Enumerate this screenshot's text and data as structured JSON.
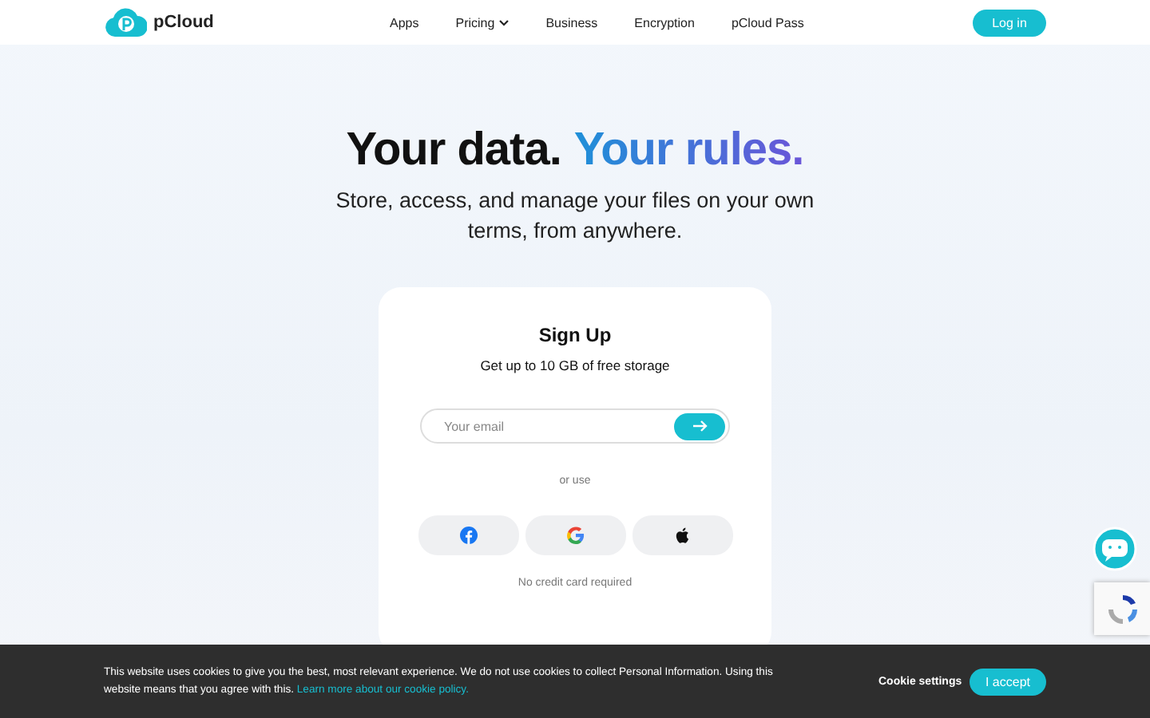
{
  "header": {
    "logo": "pCloud",
    "nav": [
      {
        "label": "Apps",
        "dropdown": false
      },
      {
        "label": "Pricing",
        "dropdown": true
      },
      {
        "label": "Business",
        "dropdown": false
      },
      {
        "label": "Encryption",
        "dropdown": false
      },
      {
        "label": "pCloud Pass",
        "dropdown": false
      }
    ],
    "login": "Log in"
  },
  "hero": {
    "headline": [
      {
        "text": "Your data.",
        "kind": "plain"
      },
      {
        "text": "Your rules.",
        "kind": "accent"
      }
    ],
    "subtitle": "Store, access, and manage your files on your own terms, from anywhere."
  },
  "signup": {
    "title": "Sign Up",
    "subtitle": "Get up to 10 GB of free storage",
    "email": {
      "placeholder": "Your email"
    },
    "or_use": "or use",
    "providers": [
      {
        "kind": "facebook"
      },
      {
        "kind": "google"
      },
      {
        "kind": "apple"
      }
    ],
    "note": "No credit card required"
  },
  "cookie_banner": {
    "text": "This website uses cookies to give you the best, most relevant experience. We do not use cookies to collect Personal Information. Using this website means that you agree with this.",
    "link": "Learn more about our cookie policy.",
    "settings": "Cookie settings",
    "accept": "I accept"
  }
}
